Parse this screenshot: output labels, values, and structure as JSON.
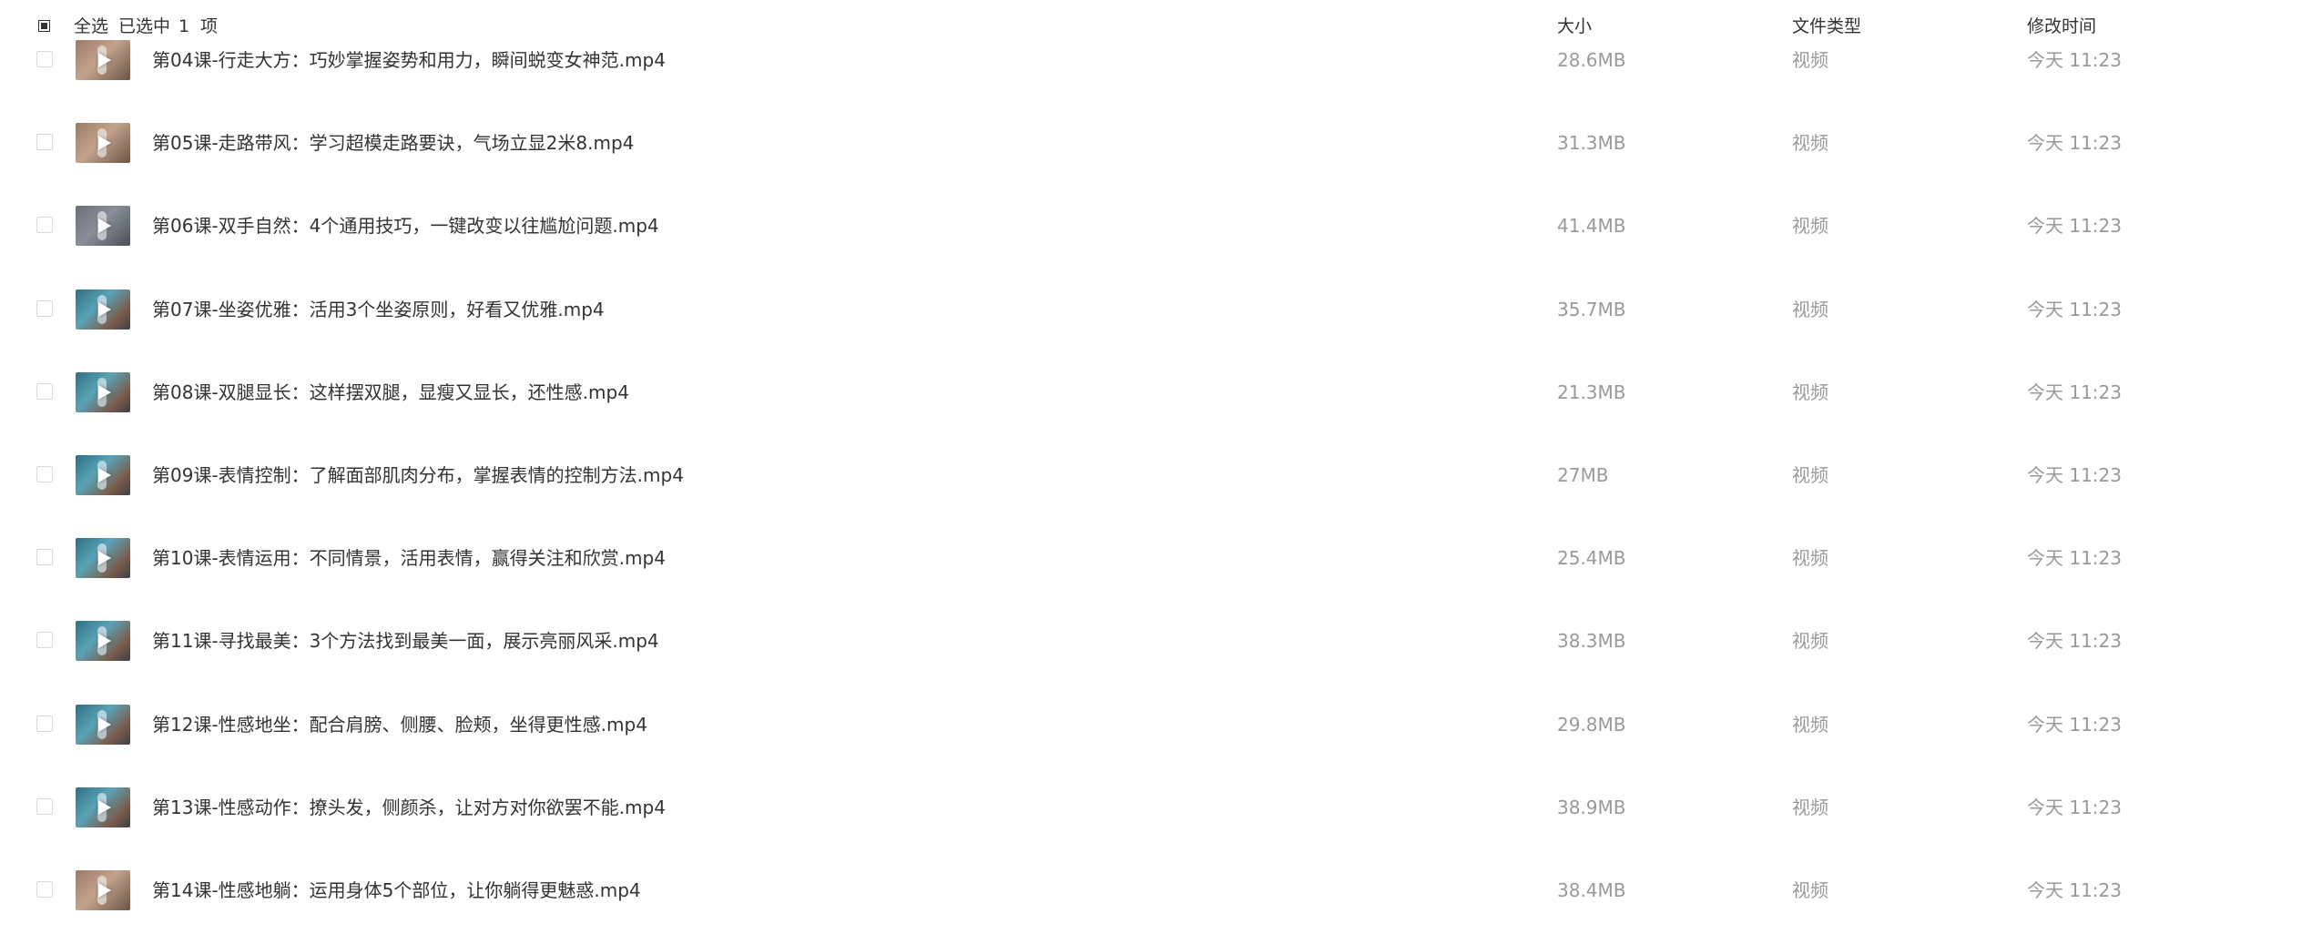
{
  "header": {
    "select_all": "全选",
    "selected_prefix": "已选中",
    "selected_count": "1",
    "selected_unit": "项",
    "col_size": "大小",
    "col_type": "文件类型",
    "col_mtime": "修改时间"
  },
  "files": [
    {
      "name": "第04课-行走大方：巧妙掌握姿势和用力，瞬间蜕变女神范.mp4",
      "size": "28.6MB",
      "type": "视频",
      "mtime": "今天 11:23",
      "thumb": "video-thumbnail"
    },
    {
      "name": "第05课-走路带风：学习超模走路要诀，气场立显2米8.mp4",
      "size": "31.3MB",
      "type": "视频",
      "mtime": "今天 11:23",
      "thumb": "video-thumbnail"
    },
    {
      "name": "第06课-双手自然：4个通用技巧，一键改变以往尴尬问题.mp4",
      "size": "41.4MB",
      "type": "视频",
      "mtime": "今天 11:23",
      "thumb": "video-thumbnail"
    },
    {
      "name": "第07课-坐姿优雅：活用3个坐姿原则，好看又优雅.mp4",
      "size": "35.7MB",
      "type": "视频",
      "mtime": "今天 11:23",
      "thumb": "video-thumbnail"
    },
    {
      "name": "第08课-双腿显长：这样摆双腿，显瘦又显长，还性感.mp4",
      "size": "21.3MB",
      "type": "视频",
      "mtime": "今天 11:23",
      "thumb": "video-thumbnail"
    },
    {
      "name": "第09课-表情控制：了解面部肌肉分布，掌握表情的控制方法.mp4",
      "size": "27MB",
      "type": "视频",
      "mtime": "今天 11:23",
      "thumb": "video-thumbnail"
    },
    {
      "name": "第10课-表情运用：不同情景，活用表情，赢得关注和欣赏.mp4",
      "size": "25.4MB",
      "type": "视频",
      "mtime": "今天 11:23",
      "thumb": "video-thumbnail"
    },
    {
      "name": "第11课-寻找最美：3个方法找到最美一面，展示亮丽风采.mp4",
      "size": "38.3MB",
      "type": "视频",
      "mtime": "今天 11:23",
      "thumb": "video-thumbnail"
    },
    {
      "name": "第12课-性感地坐：配合肩膀、侧腰、脸颊，坐得更性感.mp4",
      "size": "29.8MB",
      "type": "视频",
      "mtime": "今天 11:23",
      "thumb": "video-thumbnail"
    },
    {
      "name": "第13课-性感动作：撩头发，侧颜杀，让对方对你欲罢不能.mp4",
      "size": "38.9MB",
      "type": "视频",
      "mtime": "今天 11:23",
      "thumb": "video-thumbnail"
    },
    {
      "name": "第14课-性感地躺：运用身体5个部位，让你躺得更魅惑.mp4",
      "size": "38.4MB",
      "type": "视频",
      "mtime": "今天 11:23",
      "thumb": "video-thumbnail"
    }
  ]
}
